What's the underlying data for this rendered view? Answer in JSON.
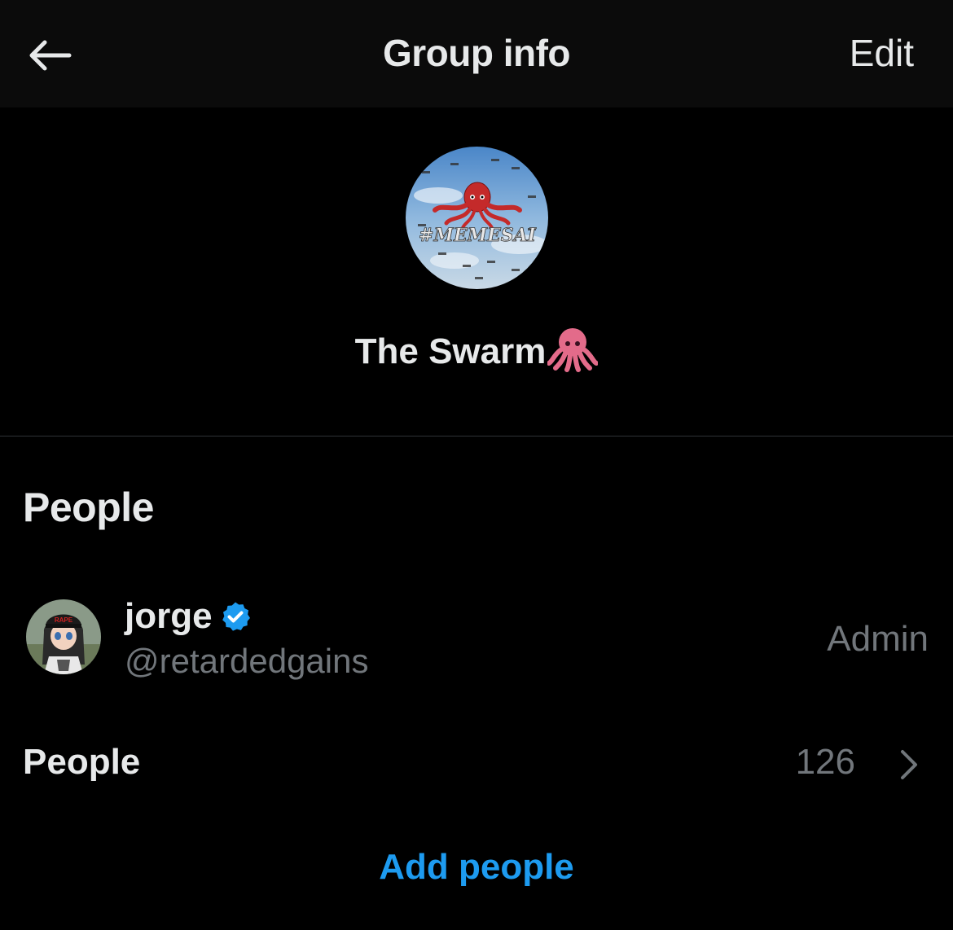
{
  "header": {
    "title": "Group info",
    "edit_label": "Edit",
    "back_icon": "arrow-left-icon"
  },
  "group": {
    "name": "The Swarm",
    "name_emoji": "octopus-emoji",
    "avatar_text": "#MEMESAI",
    "avatar_icon": "octopus-avatar"
  },
  "people_section": {
    "title": "People",
    "members": [
      {
        "name": "jorge",
        "verified": true,
        "handle": "@retardedgains",
        "role": "Admin",
        "avatar_icon": "user-avatar",
        "avatar_cap_text": "RAPE"
      }
    ],
    "people_row_label": "People",
    "people_count": "126",
    "add_people_label": "Add people"
  },
  "colors": {
    "background": "#000000",
    "header_background": "#0b0b0b",
    "text_primary": "#e7e9ea",
    "text_secondary": "#71767b",
    "accent": "#1d9bf0",
    "divider": "#2f3336"
  }
}
